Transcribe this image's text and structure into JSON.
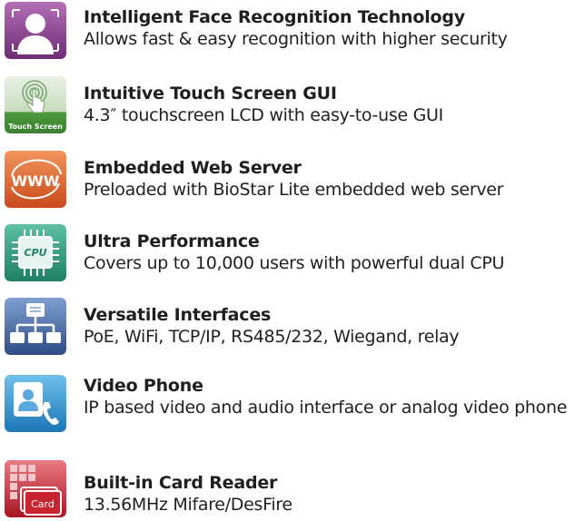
{
  "features": [
    {
      "title": "Intelligent Face Recognition Technology",
      "description": "Allows fast & easy recognition with higher security",
      "icon": "face-recognition-icon",
      "color": "#8b3f8f"
    },
    {
      "title": "Intuitive Touch Screen GUI",
      "description": "4.3″ touchscreen LCD with easy-to-use GUI",
      "icon": "touch-screen-icon",
      "icon_label": "Touch Screen",
      "color": "#4a9a3c"
    },
    {
      "title": "Embedded Web Server",
      "description": "Preloaded with BioStar Lite embedded web server",
      "icon": "www-icon",
      "icon_label": "WWW",
      "color": "#e0622a"
    },
    {
      "title": "Ultra Performance",
      "description": "Covers up to 10,000 users with powerful dual CPU",
      "icon": "cpu-icon",
      "icon_label": "CPU",
      "color": "#2e9e7c"
    },
    {
      "title": "Versatile Interfaces",
      "description": "PoE, WiFi, TCP/IP, RS485/232, Wiegand, relay",
      "icon": "network-icon",
      "color": "#3c5f9c"
    },
    {
      "title": "Video Phone",
      "description": "IP based video and audio interface or analog video phone",
      "icon": "video-phone-icon",
      "color": "#2a8fd0"
    },
    {
      "title": "Built-in Card Reader",
      "description": "13.56MHz Mifare/DesFire",
      "icon": "card-reader-icon",
      "icon_label": "Card",
      "color": "#c8232f"
    }
  ]
}
